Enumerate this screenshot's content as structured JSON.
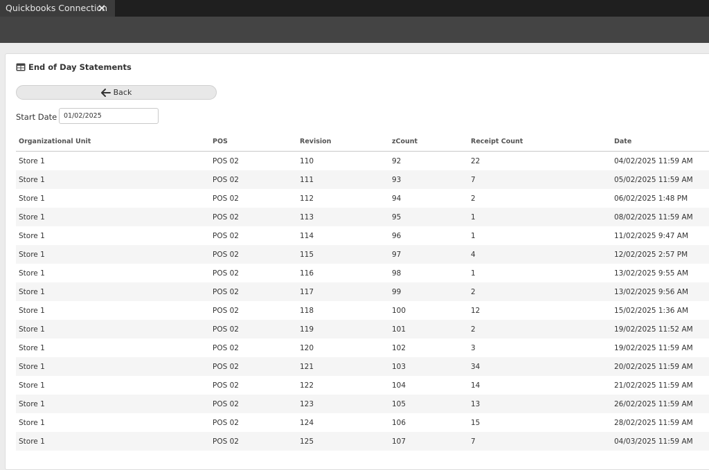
{
  "tab": {
    "title": "Quickbooks Connection",
    "close_glyph": "✕"
  },
  "panel": {
    "title": "End of Day Statements",
    "title_icon": "table-icon",
    "back_label": "Back",
    "back_icon": "arrow-left-icon",
    "start_date_label": "Start Date :",
    "start_date_value": "01/02/2025"
  },
  "table": {
    "columns": [
      "Organizational Unit",
      "POS",
      "Revision",
      "zCount",
      "Receipt Count",
      "Date"
    ],
    "rows": [
      [
        "Store 1",
        "POS 02",
        "110",
        "92",
        "22",
        "04/02/2025 11:59 AM"
      ],
      [
        "Store 1",
        "POS 02",
        "111",
        "93",
        "7",
        "05/02/2025 11:59 AM"
      ],
      [
        "Store 1",
        "POS 02",
        "112",
        "94",
        "2",
        "06/02/2025 1:48 PM"
      ],
      [
        "Store 1",
        "POS 02",
        "113",
        "95",
        "1",
        "08/02/2025 11:59 AM"
      ],
      [
        "Store 1",
        "POS 02",
        "114",
        "96",
        "1",
        "11/02/2025 9:47 AM"
      ],
      [
        "Store 1",
        "POS 02",
        "115",
        "97",
        "4",
        "12/02/2025 2:57 PM"
      ],
      [
        "Store 1",
        "POS 02",
        "116",
        "98",
        "1",
        "13/02/2025 9:55 AM"
      ],
      [
        "Store 1",
        "POS 02",
        "117",
        "99",
        "2",
        "13/02/2025 9:56 AM"
      ],
      [
        "Store 1",
        "POS 02",
        "118",
        "100",
        "12",
        "15/02/2025 1:36 AM"
      ],
      [
        "Store 1",
        "POS 02",
        "119",
        "101",
        "2",
        "19/02/2025 11:52 AM"
      ],
      [
        "Store 1",
        "POS 02",
        "120",
        "102",
        "3",
        "19/02/2025 11:59 AM"
      ],
      [
        "Store 1",
        "POS 02",
        "121",
        "103",
        "34",
        "20/02/2025 11:59 AM"
      ],
      [
        "Store 1",
        "POS 02",
        "122",
        "104",
        "14",
        "21/02/2025 11:59 AM"
      ],
      [
        "Store 1",
        "POS 02",
        "123",
        "105",
        "13",
        "26/02/2025 11:59 AM"
      ],
      [
        "Store 1",
        "POS 02",
        "124",
        "106",
        "15",
        "28/02/2025 11:59 AM"
      ],
      [
        "Store 1",
        "POS 02",
        "125",
        "107",
        "7",
        "04/03/2025 11:59 AM"
      ]
    ]
  }
}
